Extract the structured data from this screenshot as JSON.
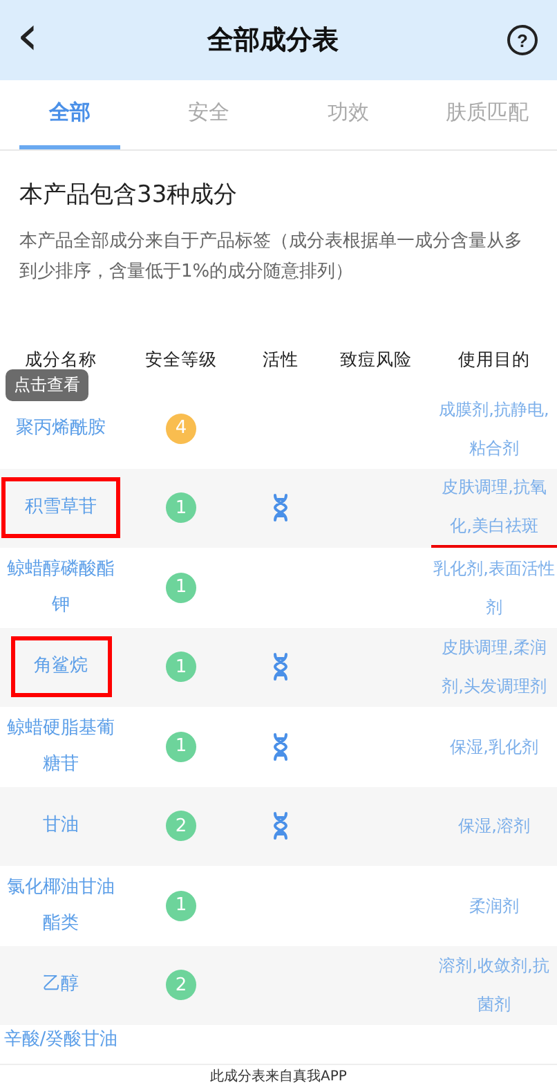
{
  "header": {
    "back": "‹",
    "title": "全部成分表",
    "help": "?"
  },
  "tabs": [
    {
      "label": "全部",
      "selected": true
    },
    {
      "label": "安全",
      "selected": false
    },
    {
      "label": "功效",
      "selected": false
    },
    {
      "label": "肤质匹配",
      "selected": false
    }
  ],
  "summary": {
    "title": "本产品包含33种成分",
    "description": "本产品全部成分来自于产品标签（成分表根据单一成分含量从多到少排序，含量低于1%的成分随意排列）"
  },
  "table": {
    "columns": [
      "成分名称",
      "安全等级",
      "活性",
      "致痘风险",
      "使用目的"
    ],
    "rows": [
      {
        "name": "聚丙烯酰胺",
        "safety": "4",
        "color": "#f9bd4f",
        "active": false,
        "purpose": "成膜剂,抗静电,粘合剂",
        "tooltip": "点击查看",
        "name_boxed": false,
        "purpose_underlined": false
      },
      {
        "name": "积雪草苷",
        "safety": "1",
        "color": "#6dd49b",
        "active": true,
        "purpose": "皮肤调理,抗氧化,美白祛斑",
        "name_boxed": true,
        "purpose_underlined": true
      },
      {
        "name": "鲸蜡醇磷酸酯钾",
        "safety": "1",
        "color": "#6dd49b",
        "active": false,
        "purpose": "乳化剂,表面活性剂",
        "name_boxed": false,
        "purpose_underlined": false
      },
      {
        "name": "角鲨烷",
        "safety": "1",
        "color": "#6dd49b",
        "active": true,
        "purpose": "皮肤调理,柔润剂,头发调理剂",
        "name_boxed": true,
        "purpose_underlined": false
      },
      {
        "name": "鲸蜡硬脂基葡糖苷",
        "safety": "1",
        "color": "#6dd49b",
        "active": true,
        "purpose": "保湿,乳化剂",
        "name_boxed": false,
        "purpose_underlined": false
      },
      {
        "name": "甘油",
        "safety": "2",
        "color": "#6dd49b",
        "active": true,
        "purpose": "保湿,溶剂",
        "name_boxed": false,
        "purpose_underlined": false
      },
      {
        "name": "氯化椰油甘油酯类",
        "safety": "1",
        "color": "#6dd49b",
        "active": false,
        "purpose": "柔润剂",
        "name_boxed": false,
        "purpose_underlined": false
      },
      {
        "name": "乙醇",
        "safety": "2",
        "color": "#6dd49b",
        "active": false,
        "purpose": "溶剂,收敛剂,抗菌剂",
        "name_boxed": false,
        "purpose_underlined": false
      }
    ],
    "partial_row": {
      "name": "辛酸/癸酸甘油"
    }
  },
  "footer": "此成分表来自真我APP"
}
